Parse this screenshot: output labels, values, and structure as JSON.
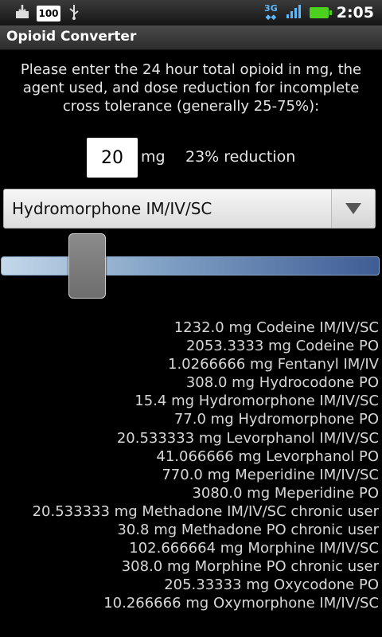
{
  "status_bar": {
    "battery_level": "100",
    "network": "3G",
    "time": "2:05",
    "battery_color": "#4ed11e"
  },
  "app": {
    "title": "Opioid Converter"
  },
  "form": {
    "instructions": "Please enter the 24 hour total opioid in mg, the agent used, and dose reduction for incomplete cross tolerance (generally 25-75%):",
    "dose_value": "20",
    "dose_unit": "mg",
    "reduction_label": "23% reduction",
    "reduction_percent": 23,
    "agent_selected": "Hydromorphone IM/IV/SC"
  },
  "results": [
    "1232.0 mg Codeine IM/IV/SC",
    "2053.3333 mg Codeine PO",
    "1.0266666 mg Fentanyl IM/IV",
    "308.0 mg Hydrocodone PO",
    "15.4 mg Hydromorphone IM/IV/SC",
    "77.0 mg Hydromorphone PO",
    "20.533333 mg Levorphanol IM/IV/SC",
    "41.066666 mg Levorphanol PO",
    "770.0 mg Meperidine IM/IV/SC",
    "3080.0 mg Meperidine PO",
    "20.533333 mg Methadone IM/IV/SC chronic user",
    "30.8 mg Methadone PO chronic user",
    "102.666664 mg Morphine IM/IV/SC",
    "308.0 mg Morphine PO chronic user",
    "205.33333 mg Oxycodone PO",
    "10.266666 mg Oxymorphone IM/IV/SC"
  ]
}
